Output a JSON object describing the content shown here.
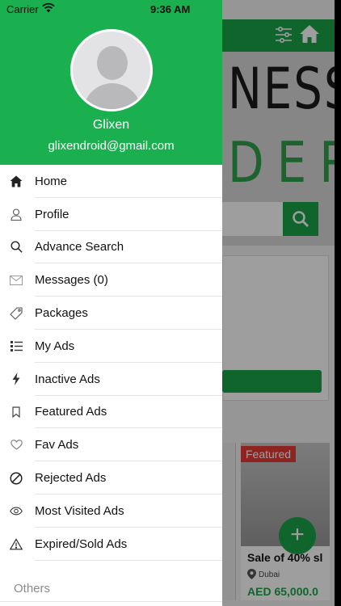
{
  "status_bar": {
    "carrier": "Carrier",
    "time": "9:36 AM"
  },
  "user": {
    "name": "Glixen",
    "email": "glixendroid@gmail.com"
  },
  "menu": [
    {
      "label": "Home",
      "icon": "home-icon"
    },
    {
      "label": "Profile",
      "icon": "user-icon"
    },
    {
      "label": "Advance Search",
      "icon": "search-icon"
    },
    {
      "label": "Messages (0)",
      "icon": "envelope-icon"
    },
    {
      "label": "Packages",
      "icon": "tag-icon"
    },
    {
      "label": "My Ads",
      "icon": "list-icon"
    },
    {
      "label": "Inactive Ads",
      "icon": "bolt-icon"
    },
    {
      "label": "Featured Ads",
      "icon": "bookmark-icon"
    },
    {
      "label": "Fav Ads",
      "icon": "heart-icon"
    },
    {
      "label": "Rejected Ads",
      "icon": "ban-icon"
    },
    {
      "label": "Most Visited Ads",
      "icon": "eye-icon"
    },
    {
      "label": "Expired/Sold  Ads",
      "icon": "warning-icon"
    }
  ],
  "section_others": "Others",
  "background": {
    "banner_line1": "NESS",
    "banner_line2": "DER",
    "listing": {
      "badge": "Featured",
      "title": "Sale of 40% sl",
      "location": "Dubai",
      "price": "AED 65,000.0"
    },
    "fab": "+"
  },
  "colors": {
    "brand_green": "#1aaf4f",
    "badge_red": "#e53935"
  }
}
